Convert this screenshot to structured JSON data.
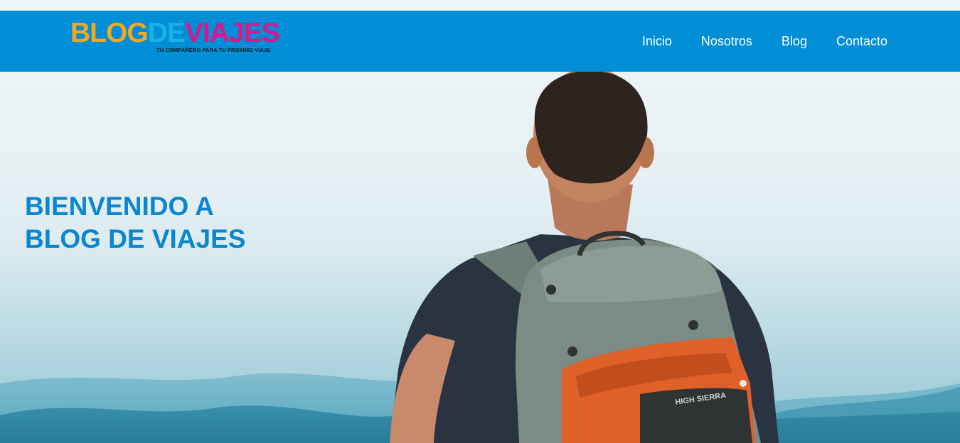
{
  "brand": {
    "word1": "BLOG",
    "word2": "DE",
    "word3": "VIAJES",
    "tagline": "TU COMPAÑERO PARA TU PRÓXIMO VIAJE",
    "colors": {
      "blog": "#f5a623",
      "de": "#1ab0e8",
      "viajes": "#d6198c"
    }
  },
  "nav": {
    "background": "#008ed6",
    "items": [
      {
        "label": "Inicio"
      },
      {
        "label": "Nosotros"
      },
      {
        "label": "Blog"
      },
      {
        "label": "Contacto"
      }
    ]
  },
  "hero": {
    "title_line1": "BIENVENIDO A",
    "title_line2": "BLOG DE VIAJES",
    "title_color": "#0a86cf",
    "image_subject": "hiker with backpack looking at mountains",
    "backpack_text": "HIGH SIERRA"
  }
}
